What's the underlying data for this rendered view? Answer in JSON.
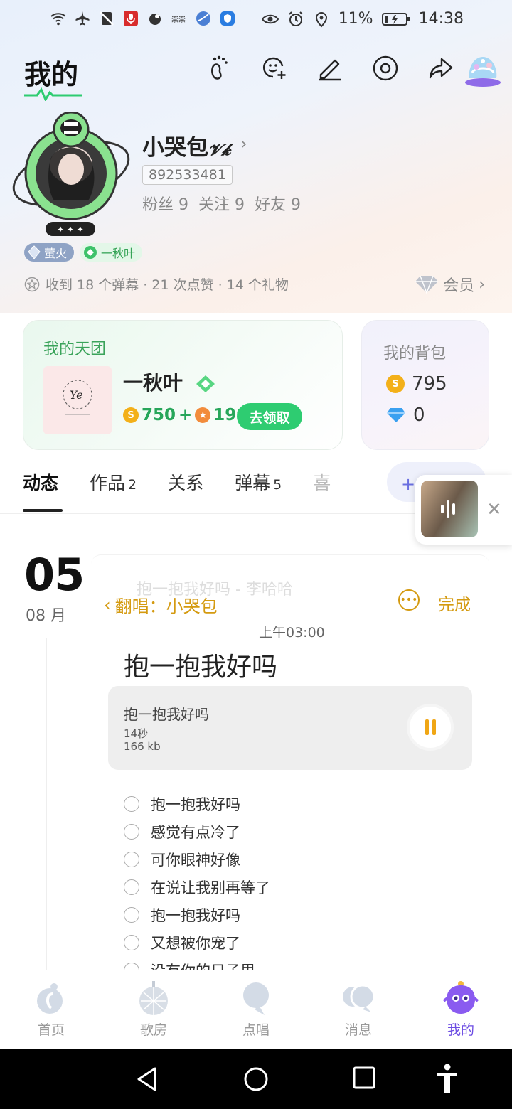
{
  "status_bar": {
    "battery": "11%",
    "time": "14:38",
    "left_icons": [
      "wifi-icon",
      "airplane-icon",
      "no-sim-icon",
      "mic-recording-icon",
      "app-icon",
      "notification-icon",
      "browser-icon",
      "shield-app-icon"
    ],
    "right_icons": [
      "eye-icon",
      "alarm-icon",
      "location-icon",
      "battery-icon"
    ]
  },
  "header": {
    "title": "我的",
    "icons": [
      "footprint-icon",
      "add-friend-icon",
      "edit-icon",
      "settings-icon",
      "share-icon",
      "decoration-icon"
    ]
  },
  "profile": {
    "nickname": "小哭包",
    "nickname_suffix": "𝓥𝓴",
    "uid": "892533481",
    "fans": "粉丝 9",
    "follows": "关注 9",
    "friends": "好友 9",
    "badge_level": "萤火",
    "badge_group": "一秋叶",
    "stats": "收到 18 个弹幕 · 21 次点赞 · 14 个礼物",
    "vip_label": "会员"
  },
  "tuan_card": {
    "title": "我的天团",
    "group_name": "一秋叶",
    "coins": "750",
    "plus": "+",
    "stars": "190",
    "claim_button": "去领取"
  },
  "bag_card": {
    "title": "我的背包",
    "coins": "795",
    "diamonds": "0"
  },
  "tabs": [
    {
      "label": "动态",
      "count": ""
    },
    {
      "label": "作品",
      "count": "2"
    },
    {
      "label": "关系",
      "count": ""
    },
    {
      "label": "弹幕",
      "count": "5"
    },
    {
      "label": "喜",
      "count": ""
    }
  ],
  "post_button": "+ 发动态",
  "timeline": {
    "day": "05",
    "month": "08 月"
  },
  "post": {
    "song_header_faint": "抱一抱我好吗 - 李哈哈",
    "back_label": "翻唱：小哭包",
    "done_label": "完成",
    "time": "上午03:00",
    "title": "抱一抱我好吗",
    "audio": {
      "name": "抱一抱我好吗",
      "duration": "14秒",
      "size": "166 kb"
    },
    "lyrics": [
      "抱一抱我好吗",
      "感觉有点冷了",
      "可你眼神好像",
      "在说让我别再等了",
      "抱一抱我好吗",
      "又想被你宠了",
      "没有你的日子里"
    ]
  },
  "bottom_nav": [
    {
      "label": "首页",
      "icon": "home-icon"
    },
    {
      "label": "歌房",
      "icon": "ktv-room-icon"
    },
    {
      "label": "点唱",
      "icon": "sing-icon"
    },
    {
      "label": "消息",
      "icon": "message-icon"
    },
    {
      "label": "我的",
      "icon": "me-icon"
    }
  ],
  "colors": {
    "accent_green": "#2ecc71",
    "accent_gold": "#d49a10",
    "active_purple": "#6d4de3"
  }
}
